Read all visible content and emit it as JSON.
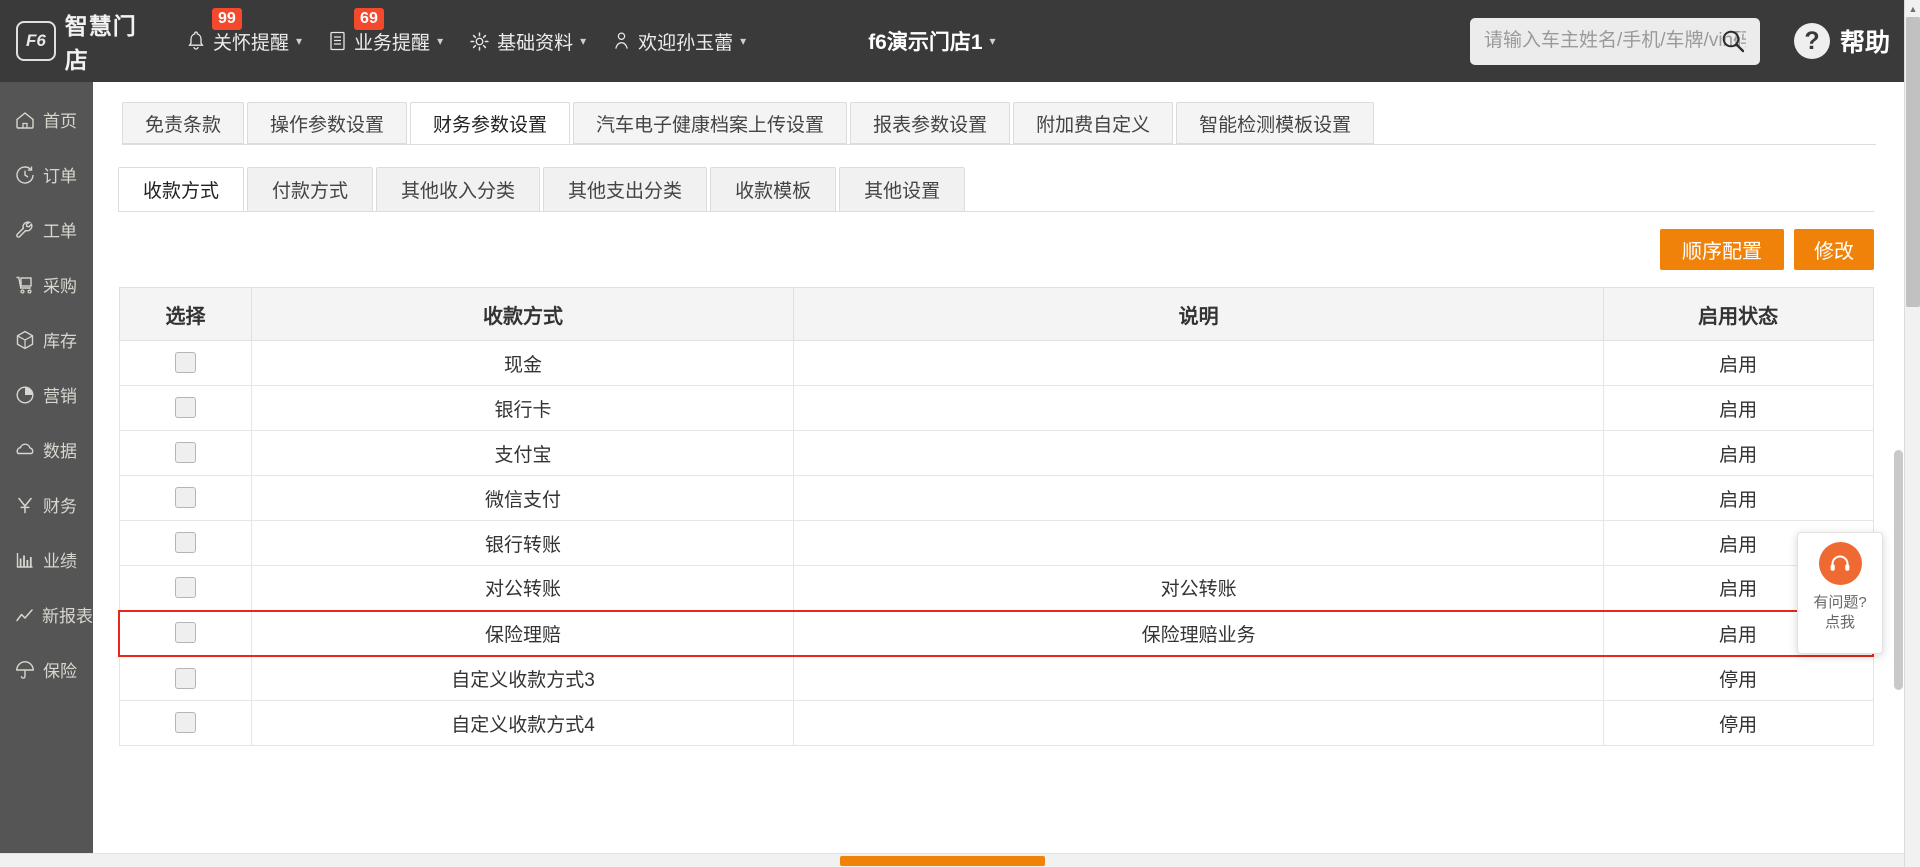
{
  "topbar": {
    "brand_logo": "F6",
    "brand_name": "智慧门店",
    "menus": [
      {
        "label": "关怀提醒",
        "badge": "99",
        "icon": "bell-icon"
      },
      {
        "label": "业务提醒",
        "badge": "69",
        "icon": "document-icon"
      },
      {
        "label": "基础资料",
        "badge": "",
        "icon": "gear-icon"
      },
      {
        "label": "欢迎孙玉蕾",
        "badge": "",
        "icon": "user-icon"
      }
    ],
    "store": "f6演示门店1",
    "search_placeholder": "请输入车主姓名/手机/车牌/vin码",
    "search_value": "",
    "help_label": "帮助",
    "help_mark": "?"
  },
  "sidebar": {
    "items": [
      {
        "label": "首页",
        "icon": "home-icon"
      },
      {
        "label": "订单",
        "icon": "clock-icon"
      },
      {
        "label": "工单",
        "icon": "wrench-icon"
      },
      {
        "label": "采购",
        "icon": "cart-icon"
      },
      {
        "label": "库存",
        "icon": "box-icon"
      },
      {
        "label": "营销",
        "icon": "pie-icon"
      },
      {
        "label": "数据",
        "icon": "cloud-icon"
      },
      {
        "label": "财务",
        "icon": "yuan-icon"
      },
      {
        "label": "业绩",
        "icon": "bar-chart-icon"
      },
      {
        "label": "新报表",
        "icon": "line-chart-icon"
      },
      {
        "label": "保险",
        "icon": "umbrella-icon"
      }
    ]
  },
  "main": {
    "tabs_primary": [
      {
        "label": "免责条款",
        "active": false
      },
      {
        "label": "操作参数设置",
        "active": false
      },
      {
        "label": "财务参数设置",
        "active": true
      },
      {
        "label": "汽车电子健康档案上传设置",
        "active": false
      },
      {
        "label": "报表参数设置",
        "active": false
      },
      {
        "label": "附加费自定义",
        "active": false
      },
      {
        "label": "智能检测模板设置",
        "active": false
      }
    ],
    "tabs_secondary": [
      {
        "label": "收款方式",
        "active": true
      },
      {
        "label": "付款方式",
        "active": false
      },
      {
        "label": "其他收入分类",
        "active": false
      },
      {
        "label": "其他支出分类",
        "active": false
      },
      {
        "label": "收款模板",
        "active": false
      },
      {
        "label": "其他设置",
        "active": false
      }
    ],
    "buttons": [
      {
        "label": "顺序配置",
        "name": "order-config-button"
      },
      {
        "label": "修改",
        "name": "edit-button"
      }
    ],
    "table": {
      "columns": [
        "选择",
        "收款方式",
        "说明",
        "启用状态"
      ],
      "rows": [
        {
          "way": "现金",
          "desc": "",
          "status": "启用",
          "highlight": false
        },
        {
          "way": "银行卡",
          "desc": "",
          "status": "启用",
          "highlight": false
        },
        {
          "way": "支付宝",
          "desc": "",
          "status": "启用",
          "highlight": false
        },
        {
          "way": "微信支付",
          "desc": "",
          "status": "启用",
          "highlight": false
        },
        {
          "way": "银行转账",
          "desc": "",
          "status": "启用",
          "highlight": false
        },
        {
          "way": "对公转账",
          "desc": "对公转账",
          "status": "启用",
          "highlight": false
        },
        {
          "way": "保险理赔",
          "desc": "保险理赔业务",
          "status": "启用",
          "highlight": true
        },
        {
          "way": "自定义收款方式3",
          "desc": "",
          "status": "停用",
          "highlight": false
        },
        {
          "way": "自定义收款方式4",
          "desc": "",
          "status": "停用",
          "highlight": false
        }
      ]
    }
  },
  "chat": {
    "line1": "有问题?",
    "line2": "点我"
  },
  "colors": {
    "accent_orange": "#f0820a",
    "badge_red": "#f4492d",
    "highlight_red": "#e8271a",
    "topbar_bg": "#3a3a3a",
    "sidebar_bg": "#555555",
    "chat_orange": "#ef6a33"
  }
}
